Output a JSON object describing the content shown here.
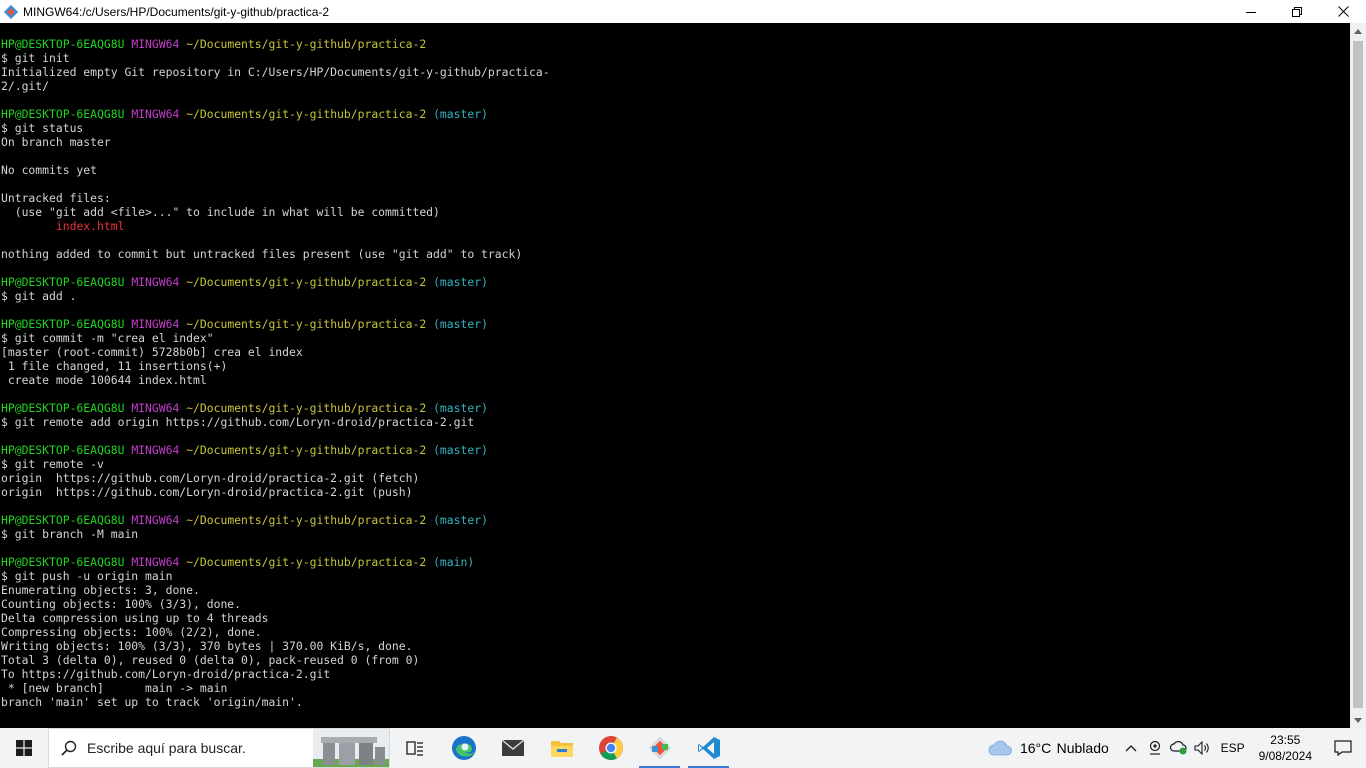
{
  "window": {
    "title": "MINGW64:/c/Users/HP/Documents/git-y-github/practica-2",
    "controls": {
      "minimize": "—",
      "maximize": "❐",
      "close": "✕"
    }
  },
  "colors": {
    "user": "#1fd51f",
    "host": "#c13dc9",
    "path": "#c8c43a",
    "branch": "#32b3c2",
    "untracked": "#e8323b",
    "text": "#d4d4d4",
    "background": "#000000"
  },
  "terminal": {
    "lines": [
      {
        "spans": [
          {
            "t": "HP@DESKTOP-6EAQG8U",
            "c": "user"
          },
          {
            "t": " "
          },
          {
            "t": "MINGW64",
            "c": "host"
          },
          {
            "t": " "
          },
          {
            "t": "~/Documents/git-y-github/practica-2",
            "c": "path"
          }
        ]
      },
      {
        "spans": [
          {
            "t": "$ git init"
          }
        ]
      },
      {
        "spans": [
          {
            "t": "Initialized empty Git repository in C:/Users/HP/Documents/git-y-github/practica-"
          }
        ]
      },
      {
        "spans": [
          {
            "t": "2/.git/"
          }
        ]
      },
      {
        "spans": []
      },
      {
        "spans": [
          {
            "t": "HP@DESKTOP-6EAQG8U",
            "c": "user"
          },
          {
            "t": " "
          },
          {
            "t": "MINGW64",
            "c": "host"
          },
          {
            "t": " "
          },
          {
            "t": "~/Documents/git-y-github/practica-2",
            "c": "path"
          },
          {
            "t": " "
          },
          {
            "t": "(master)",
            "c": "branch"
          }
        ]
      },
      {
        "spans": [
          {
            "t": "$ git status"
          }
        ]
      },
      {
        "spans": [
          {
            "t": "On branch master"
          }
        ]
      },
      {
        "spans": []
      },
      {
        "spans": [
          {
            "t": "No commits yet"
          }
        ]
      },
      {
        "spans": []
      },
      {
        "spans": [
          {
            "t": "Untracked files:"
          }
        ]
      },
      {
        "spans": [
          {
            "t": "  (use \"git add <file>...\" to include in what will be committed)"
          }
        ]
      },
      {
        "spans": [
          {
            "t": "        "
          },
          {
            "t": "index.html",
            "c": "red"
          }
        ]
      },
      {
        "spans": []
      },
      {
        "spans": [
          {
            "t": "nothing added to commit but untracked files present (use \"git add\" to track)"
          }
        ]
      },
      {
        "spans": []
      },
      {
        "spans": [
          {
            "t": "HP@DESKTOP-6EAQG8U",
            "c": "user"
          },
          {
            "t": " "
          },
          {
            "t": "MINGW64",
            "c": "host"
          },
          {
            "t": " "
          },
          {
            "t": "~/Documents/git-y-github/practica-2",
            "c": "path"
          },
          {
            "t": " "
          },
          {
            "t": "(master)",
            "c": "branch"
          }
        ]
      },
      {
        "spans": [
          {
            "t": "$ git add ."
          }
        ]
      },
      {
        "spans": []
      },
      {
        "spans": [
          {
            "t": "HP@DESKTOP-6EAQG8U",
            "c": "user"
          },
          {
            "t": " "
          },
          {
            "t": "MINGW64",
            "c": "host"
          },
          {
            "t": " "
          },
          {
            "t": "~/Documents/git-y-github/practica-2",
            "c": "path"
          },
          {
            "t": " "
          },
          {
            "t": "(master)",
            "c": "branch"
          }
        ]
      },
      {
        "spans": [
          {
            "t": "$ git commit -m \"crea el index\""
          }
        ]
      },
      {
        "spans": [
          {
            "t": "[master (root-commit) 5728b0b] crea el index"
          }
        ]
      },
      {
        "spans": [
          {
            "t": " 1 file changed, 11 insertions(+)"
          }
        ]
      },
      {
        "spans": [
          {
            "t": " create mode 100644 index.html"
          }
        ]
      },
      {
        "spans": []
      },
      {
        "spans": [
          {
            "t": "HP@DESKTOP-6EAQG8U",
            "c": "user"
          },
          {
            "t": " "
          },
          {
            "t": "MINGW64",
            "c": "host"
          },
          {
            "t": " "
          },
          {
            "t": "~/Documents/git-y-github/practica-2",
            "c": "path"
          },
          {
            "t": " "
          },
          {
            "t": "(master)",
            "c": "branch"
          }
        ]
      },
      {
        "spans": [
          {
            "t": "$ git remote add origin https://github.com/Loryn-droid/practica-2.git"
          }
        ]
      },
      {
        "spans": []
      },
      {
        "spans": [
          {
            "t": "HP@DESKTOP-6EAQG8U",
            "c": "user"
          },
          {
            "t": " "
          },
          {
            "t": "MINGW64",
            "c": "host"
          },
          {
            "t": " "
          },
          {
            "t": "~/Documents/git-y-github/practica-2",
            "c": "path"
          },
          {
            "t": " "
          },
          {
            "t": "(master)",
            "c": "branch"
          }
        ]
      },
      {
        "spans": [
          {
            "t": "$ git remote -v"
          }
        ]
      },
      {
        "spans": [
          {
            "t": "origin  https://github.com/Loryn-droid/practica-2.git (fetch)"
          }
        ]
      },
      {
        "spans": [
          {
            "t": "origin  https://github.com/Loryn-droid/practica-2.git (push)"
          }
        ]
      },
      {
        "spans": []
      },
      {
        "spans": [
          {
            "t": "HP@DESKTOP-6EAQG8U",
            "c": "user"
          },
          {
            "t": " "
          },
          {
            "t": "MINGW64",
            "c": "host"
          },
          {
            "t": " "
          },
          {
            "t": "~/Documents/git-y-github/practica-2",
            "c": "path"
          },
          {
            "t": " "
          },
          {
            "t": "(master)",
            "c": "branch"
          }
        ]
      },
      {
        "spans": [
          {
            "t": "$ git branch -M main"
          }
        ]
      },
      {
        "spans": []
      },
      {
        "spans": [
          {
            "t": "HP@DESKTOP-6EAQG8U",
            "c": "user"
          },
          {
            "t": " "
          },
          {
            "t": "MINGW64",
            "c": "host"
          },
          {
            "t": " "
          },
          {
            "t": "~/Documents/git-y-github/practica-2",
            "c": "path"
          },
          {
            "t": " "
          },
          {
            "t": "(main)",
            "c": "branch"
          }
        ]
      },
      {
        "spans": [
          {
            "t": "$ git push -u origin main"
          }
        ]
      },
      {
        "spans": [
          {
            "t": "Enumerating objects: 3, done."
          }
        ]
      },
      {
        "spans": [
          {
            "t": "Counting objects: 100% (3/3), done."
          }
        ]
      },
      {
        "spans": [
          {
            "t": "Delta compression using up to 4 threads"
          }
        ]
      },
      {
        "spans": [
          {
            "t": "Compressing objects: 100% (2/2), done."
          }
        ]
      },
      {
        "spans": [
          {
            "t": "Writing objects: 100% (3/3), 370 bytes | 370.00 KiB/s, done."
          }
        ]
      },
      {
        "spans": [
          {
            "t": "Total 3 (delta 0), reused 0 (delta 0), pack-reused 0 (from 0)"
          }
        ]
      },
      {
        "spans": [
          {
            "t": "To https://github.com/Loryn-droid/practica-2.git"
          }
        ]
      },
      {
        "spans": [
          {
            "t": " * [new branch]      main -> main"
          }
        ]
      },
      {
        "spans": [
          {
            "t": "branch 'main' set up to track 'origin/main'."
          }
        ]
      }
    ]
  },
  "taskbar": {
    "search_placeholder": "Escribe aquí para buscar.",
    "apps": [
      {
        "name": "task-view",
        "icon": "task-view-icon"
      },
      {
        "name": "edge",
        "icon": "edge-icon"
      },
      {
        "name": "mail",
        "icon": "mail-icon"
      },
      {
        "name": "file-explorer",
        "icon": "folder-icon"
      },
      {
        "name": "chrome",
        "icon": "chrome-icon"
      },
      {
        "name": "git-bash",
        "icon": "git-bash-icon"
      },
      {
        "name": "vscode",
        "icon": "vscode-icon"
      }
    ],
    "weather": {
      "temp": "16°C",
      "desc": "Nublado"
    },
    "language": "ESP",
    "time": "23:55",
    "date": "9/08/2024"
  }
}
